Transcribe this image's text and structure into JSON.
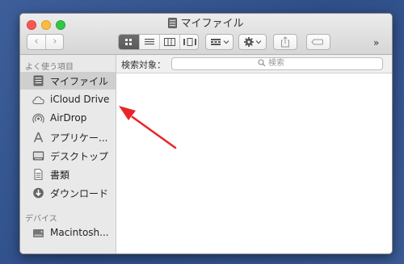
{
  "window": {
    "title": "マイファイル"
  },
  "toolbar": {
    "more_label": "»"
  },
  "sidebar": {
    "favorites_header": "よく使う項目",
    "favorites": [
      {
        "label": "マイファイル",
        "icon": "my-files-icon"
      },
      {
        "label": "iCloud Drive",
        "icon": "cloud-icon"
      },
      {
        "label": "AirDrop",
        "icon": "airdrop-icon"
      },
      {
        "label": "アプリケー...",
        "icon": "applications-icon"
      },
      {
        "label": "デスクトップ",
        "icon": "desktop-icon"
      },
      {
        "label": "書類",
        "icon": "documents-icon"
      },
      {
        "label": "ダウンロード",
        "icon": "downloads-icon"
      }
    ],
    "devices_header": "デバイス",
    "devices": [
      {
        "label": "Macintosh...",
        "icon": "hard-disk-icon"
      }
    ]
  },
  "scopebar": {
    "label": "検索対象：",
    "search_placeholder": "検索"
  },
  "annotation": {
    "color": "#e8262a"
  }
}
